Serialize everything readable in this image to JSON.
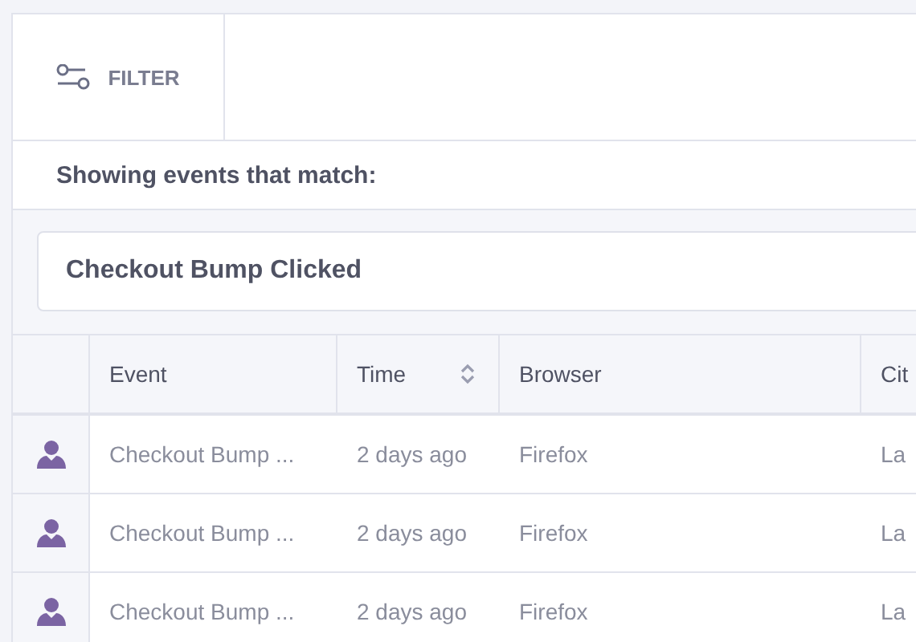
{
  "filter_button": {
    "label": "FILTER"
  },
  "match_label": "Showing events that match:",
  "event_field": {
    "value": "Checkout Bump Clicked"
  },
  "table": {
    "columns": [
      {
        "label": "Event",
        "sortable": false
      },
      {
        "label": "Time",
        "sortable": true
      },
      {
        "label": "Browser",
        "sortable": false
      },
      {
        "label": "Cit"
      }
    ],
    "rows": [
      {
        "cells": [
          "Checkout Bump ...",
          "2 days ago",
          "Firefox",
          "La"
        ]
      },
      {
        "cells": [
          "Checkout Bump ...",
          "2 days ago",
          "Firefox",
          "La"
        ]
      },
      {
        "cells": [
          "Checkout Bump ...",
          "2 days ago",
          "Firefox",
          "La"
        ]
      }
    ]
  }
}
